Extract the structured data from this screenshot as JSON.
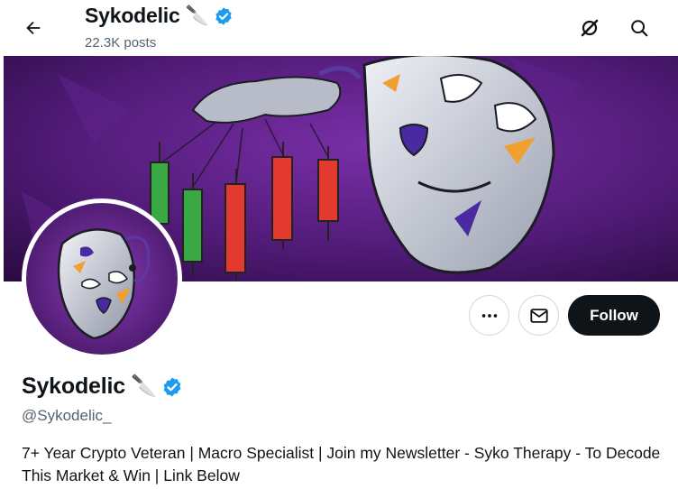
{
  "header": {
    "name": "Sykodelic",
    "emoji": "🔪",
    "posts": "22.3K posts"
  },
  "profile": {
    "name": "Sykodelic",
    "emoji": "🔪",
    "handle": "@Sykodelic_",
    "bio": "7+ Year Crypto Veteran | Macro Specialist | Join my Newsletter - Syko Therapy - To Decode This Market & Win | Link Below"
  },
  "actions": {
    "follow_label": "Follow"
  },
  "icons": {
    "back": "arrow-left-icon",
    "grok": "grok-icon",
    "search": "search-icon",
    "more": "more-icon",
    "message": "envelope-icon",
    "verified": "verified-badge-icon"
  },
  "colors": {
    "verified_blue": "#1d9bf0",
    "follow_bg": "#0f1419",
    "banner_purple": "#4a1a6e"
  }
}
